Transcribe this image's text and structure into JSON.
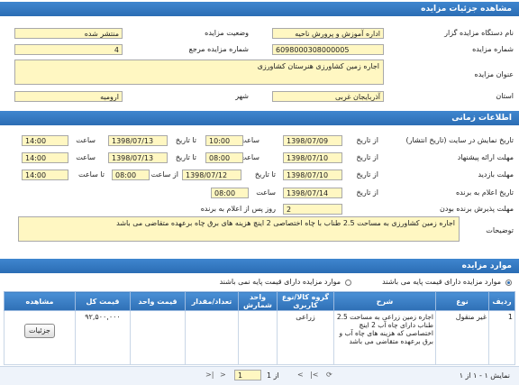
{
  "details": {
    "header": "مشاهده جزئیات مزایده",
    "org_label": "نام دستگاه مزایده گزار",
    "org_value": "اداره آموزش و پرورش ناحیه",
    "status_label": "وضعیت مزایده",
    "status_value": "منتشر شده",
    "number_label": "شماره مزایده",
    "number_value": "6098000308000005",
    "ref_label": "شماره مزایده مرجع",
    "ref_value": "4",
    "title_label": "عنوان مزایده",
    "title_value": "اجاره زمین کشاورزی هنرستان کشاورزی",
    "province_label": "استان",
    "province_value": "آذربایجان غربی",
    "city_label": "شهر",
    "city_value": "ارومیه"
  },
  "timing": {
    "header": "اطلاعات زمانی",
    "publish_label": "تاریخ نمایش در سایت (تاریخ انتشار)",
    "from_label": "از تاریخ",
    "publish_from": "1398/07/09",
    "time_label": "ساعت",
    "publish_from_time": "10:00",
    "to_label": "تا تاریخ",
    "publish_to": "1398/07/13",
    "publish_to_time": "14:00",
    "offer_label": "مهلت ارائه پیشنهاد",
    "offer_from": "1398/07/10",
    "offer_from_time": "08:00",
    "offer_to": "1398/07/13",
    "offer_to_time": "14:00",
    "visit_label": "مهلت بازدید",
    "visit_from": "1398/07/10",
    "visit_from_label": "از تاریخ",
    "visit_to_label": "تا تاریخ",
    "visit_to": "1398/07/12",
    "visit_from_time_label": "از ساعت",
    "visit_from_time": "08:00",
    "visit_to_time_label": "تا ساعت",
    "visit_to_time": "14:00",
    "announce_label": "تاریخ اعلام به برنده",
    "announce_from_label": "از تاریخ",
    "announce_date": "1398/07/14",
    "announce_time_label": "ساعت",
    "announce_time": "08:00",
    "winner_label": "مهلت پذیرش برنده بودن",
    "winner_value": "2",
    "winner_suffix": "روز پس از اعلام به برنده",
    "desc_label": "توضیحات",
    "desc_value": "اجاره زمین کشاورزی به مساحت 2.5 طناب با چاه اختصاصی 2 اینچ هزینه های برق چاه برعهده متقاضی می باشد"
  },
  "items": {
    "header": "موارد مزایده",
    "radio_with_price": "موارد مزایده دارای قیمت پایه می باشند",
    "radio_without_price": "موارد مزایده دارای قیمت پایه نمی باشند",
    "columns": [
      "ردیف",
      "نوع",
      "شرح",
      "گروه کالا/نوع کاربری",
      "واحد شمارش",
      "تعداد/مقدار",
      "قیمت واحد",
      "قیمت کل",
      "مشاهده"
    ],
    "rows": [
      {
        "row": "1",
        "type": "غیر منقول",
        "desc": "اجاره زمین زراعی به مساحت 2.5 طناب دارای چاه آب 2 اینچ اختصاصی که هزینه های چاه آب و برق برعهده متقاضی می باشد",
        "group": "زراعی",
        "unit": "",
        "qty": "",
        "unit_price": "",
        "total": "۹۲,۵۰۰,۰۰۰",
        "view_label": "جزئیات"
      }
    ]
  },
  "pager": {
    "summary": "نمایش ۱ - ۱ از ۱",
    "page_of": "از 1",
    "page_value": "1"
  },
  "colors": {
    "header_blue": "#2b6db4",
    "field_yellow": "#fff7c2"
  }
}
